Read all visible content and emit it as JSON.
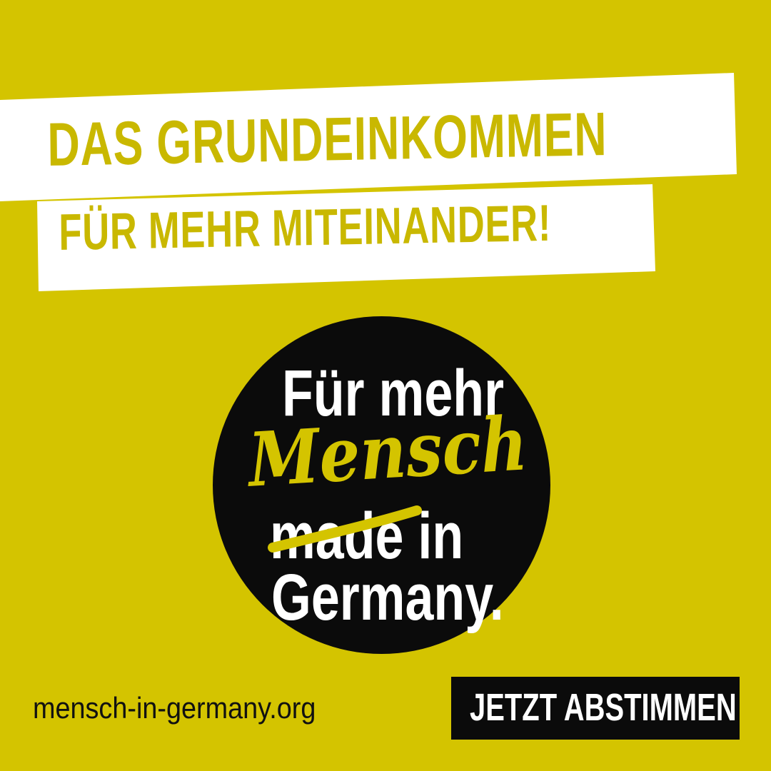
{
  "colors": {
    "background": "#d4c400",
    "headline_text": "#c9b800",
    "banner": "#ffffff",
    "badge": "#0b0b0b",
    "accent": "#d4c400"
  },
  "headline": {
    "line1": "DAS GRUNDEINKOMMEN",
    "line2": "FÜR MEHR MITEINANDER!"
  },
  "badge": {
    "line1": "Für mehr",
    "highlight": "Mensch",
    "struck_word": "made",
    "line3_rest": " in",
    "line4": "Germany."
  },
  "footer": {
    "url": "mensch-in-germany.org",
    "cta_label": "JETZT ABSTIMMEN"
  }
}
